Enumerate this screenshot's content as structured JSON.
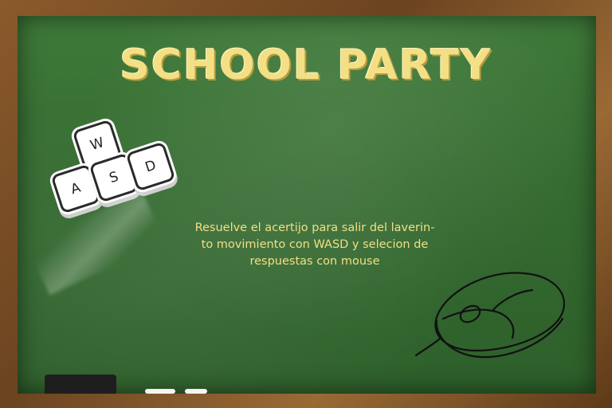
{
  "title": "SCHOOL PARTY",
  "keys": {
    "w": "W",
    "a": "A",
    "s": "S",
    "d": "D"
  },
  "instructions": [
    "Resuelve el acertijo para salir del laverin-",
    "to movimiento con WASD y selecion de",
    "respuestas con mouse"
  ],
  "colors": {
    "chalk_yellow": "#f3df85",
    "board_green": "#356b31",
    "frame_wood": "#8a5a2b"
  },
  "icons": {
    "keyboard": "wasd-keys-icon",
    "mouse": "mouse-icon"
  }
}
